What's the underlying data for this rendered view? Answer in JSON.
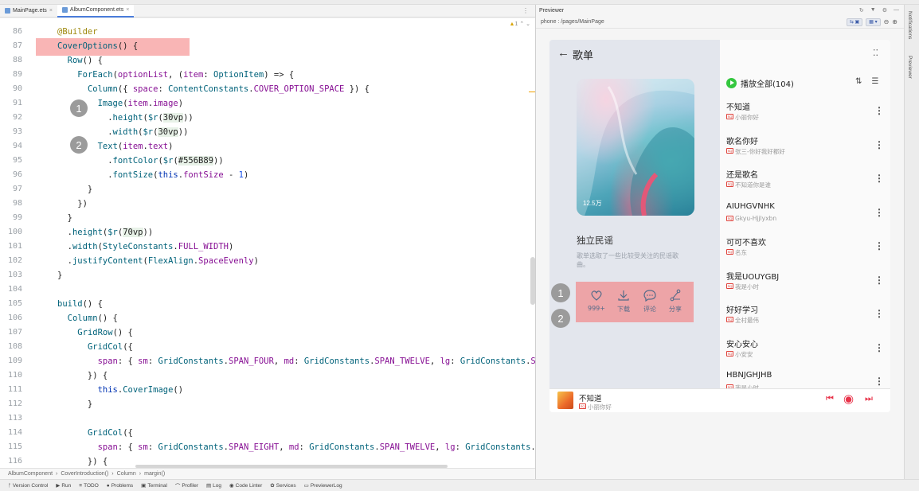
{
  "editor": {
    "tabs": [
      {
        "label": "MainPage.ets",
        "active": false
      },
      {
        "label": "AlbumComponent.ets",
        "active": true
      }
    ],
    "warning_count": "1",
    "lines": [
      {
        "n": "86",
        "html": "<span class='ann'>@Builder</span>"
      },
      {
        "n": "87",
        "html": "<span class='fn'>CoverOptions</span>() {"
      },
      {
        "n": "88",
        "html": "  <span class='fn'>Row</span>() {"
      },
      {
        "n": "89",
        "html": "    <span class='fn'>ForEach</span>(<span class='prm'>optionList</span>, (<span class='prm'>item</span>: <span class='fn'>OptionItem</span>) => {"
      },
      {
        "n": "90",
        "html": "      <span class='fn'>Column</span>({ <span class='prm'>space</span>: <span class='fn'>ContentConstants</span>.<span class='prm'>COVER_OPTION_SPACE</span> }) {"
      },
      {
        "n": "91",
        "html": "        <span class='fn'>Image</span>(<span class='prm'>item</span>.<span class='prm'>image</span>)"
      },
      {
        "n": "92",
        "html": "          .<span class='fn'>height</span>(<span class='fn'>$r</span>(<span class='chip'>30vp</span>))"
      },
      {
        "n": "93",
        "html": "          .<span class='fn'>width</span>(<span class='fn'>$r</span>(<span class='chip'>30vp</span>))"
      },
      {
        "n": "94",
        "html": "        <span class='fn'>Text</span>(<span class='prm'>item</span>.<span class='prm'>text</span>)"
      },
      {
        "n": "95",
        "html": "          .<span class='fn'>fontColor</span>(<span class='fn'>$r</span>(<span class='chip'>#556B89</span>))"
      },
      {
        "n": "96",
        "html": "          .<span class='fn'>fontSize</span>(<span class='kw'>this</span>.<span class='prm'>fontSize</span> - <span class='num'>1</span>)"
      },
      {
        "n": "97",
        "html": "      }"
      },
      {
        "n": "98",
        "html": "    })"
      },
      {
        "n": "99",
        "html": "  }"
      },
      {
        "n": "100",
        "html": "  .<span class='fn'>height</span>(<span class='fn'>$r</span>(<span class='chip'>70vp</span>))"
      },
      {
        "n": "101",
        "html": "  .<span class='fn'>width</span>(<span class='fn'>StyleConstants</span>.<span class='prm'>FULL_WIDTH</span>)"
      },
      {
        "n": "102",
        "html": "  .<span class='fn'>justifyContent</span>(<span class='fn'>FlexAlign</span>.<span class='prm'>SpaceEvenly</span>)"
      },
      {
        "n": "103",
        "html": "}"
      },
      {
        "n": "104",
        "html": ""
      },
      {
        "n": "105",
        "html": "<span class='fn'>build</span>() {"
      },
      {
        "n": "106",
        "html": "  <span class='fn'>Column</span>() {"
      },
      {
        "n": "107",
        "html": "    <span class='fn'>GridRow</span>() {"
      },
      {
        "n": "108",
        "html": "      <span class='fn'>GridCol</span>({"
      },
      {
        "n": "109",
        "html": "        <span class='prm'>span</span>: { <span class='prm'>sm</span>: <span class='fn'>GridConstants</span>.<span class='prm'>SPAN_FOUR</span>, <span class='prm'>md</span>: <span class='fn'>GridConstants</span>.<span class='prm'>SPAN_TWELVE</span>, <span class='prm'>lg</span>: <span class='fn'>GridConstants</span>.<span class='prm'>S</span>"
      },
      {
        "n": "110",
        "html": "      }) {"
      },
      {
        "n": "111",
        "html": "        <span class='kw'>this</span>.<span class='fn'>CoverImage</span>()"
      },
      {
        "n": "112",
        "html": "      }"
      },
      {
        "n": "113",
        "html": ""
      },
      {
        "n": "114",
        "html": "      <span class='fn'>GridCol</span>({"
      },
      {
        "n": "115",
        "html": "        <span class='prm'>span</span>: { <span class='prm'>sm</span>: <span class='fn'>GridConstants</span>.<span class='prm'>SPAN_EIGHT</span>, <span class='prm'>md</span>: <span class='fn'>GridConstants</span>.<span class='prm'>SPAN_TWELVE</span>, <span class='prm'>lg</span>: <span class='fn'>GridConstants</span>."
      },
      {
        "n": "116",
        "html": "      }) {"
      }
    ],
    "badges": [
      "1",
      "2"
    ]
  },
  "breadcrumb": [
    "AlbumComponent",
    "CoverIntroduction()",
    "Column",
    "margin()"
  ],
  "bottombar": [
    "Version Control",
    "Run",
    "TODO",
    "Problems",
    "Terminal",
    "Profiler",
    "Log",
    "Code Linter",
    "Services",
    "PreviewerLog"
  ],
  "previewer": {
    "title": "Previewer",
    "path": "phone : /pages/MainPage",
    "side_tabs": [
      "Notifications",
      "Previewer"
    ]
  },
  "app": {
    "back_icon": "arrow-left-icon",
    "title": "歌单",
    "cover_count": "12.5万",
    "album_name": "独立民谣",
    "album_desc": "歌单选取了一些比较受关注的民谣歌曲。",
    "options": [
      {
        "icon": "heart-icon",
        "label": "999+"
      },
      {
        "icon": "download-icon",
        "label": "下载"
      },
      {
        "icon": "comment-icon",
        "label": "评论"
      },
      {
        "icon": "share-icon",
        "label": "分享"
      }
    ],
    "badges": [
      "1",
      "2"
    ],
    "play_all": "播放全部(104)",
    "songs": [
      {
        "name": "不知道",
        "artist": "小丽你好"
      },
      {
        "name": "歌名你好",
        "artist": "张三-你好我好都好"
      },
      {
        "name": "还是歌名",
        "artist": "不知道你是谁"
      },
      {
        "name": "AIUHGVNHK",
        "artist": "Gkyu-Hjjlyxbn"
      },
      {
        "name": "可可不喜欢",
        "artist": "名东"
      },
      {
        "name": "我是UOUYGBJ",
        "artist": "我是小时"
      },
      {
        "name": "好好学习",
        "artist": "全村最伟"
      },
      {
        "name": "安心安心",
        "artist": "小安安"
      },
      {
        "name": "HBNJGHJHB",
        "artist": "我是小时"
      }
    ],
    "player": {
      "name": "不知道",
      "artist": "小丽你好"
    },
    "accent": "#e8334a",
    "option_color": "#556B89"
  }
}
